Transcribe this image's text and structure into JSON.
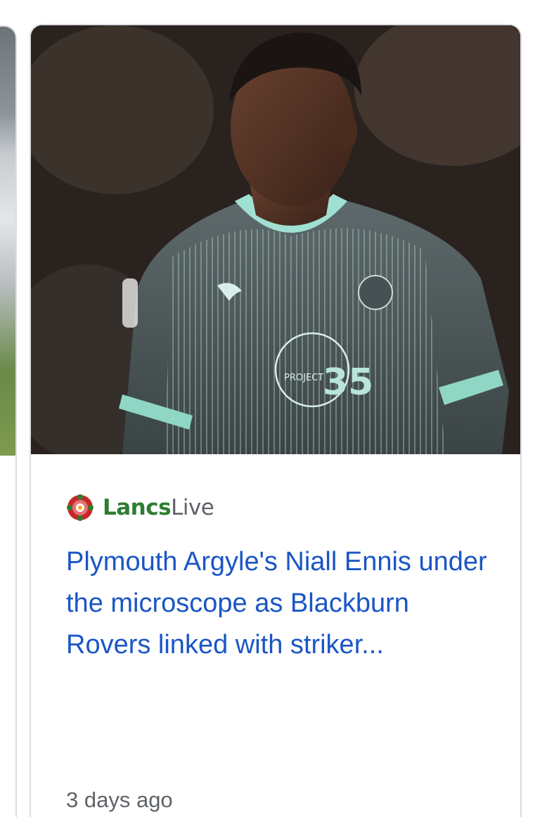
{
  "card": {
    "image_alt": "Footballer in grey Plymouth Argyle shirt",
    "source": {
      "name_strong": "Lancs",
      "name_light": "Live",
      "logo_icon": "red-rose-icon",
      "logo_color": "#c62828",
      "brand_color": "#2e7d32"
    },
    "headline": "Plymouth Argyle's Niall Ennis under the microscope as Blackburn Rovers linked with striker...",
    "timestamp": "3 days ago",
    "link_color": "#1a56c4"
  }
}
